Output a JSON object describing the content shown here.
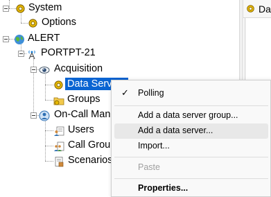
{
  "tree": {
    "system": "System",
    "options": "Options",
    "alert": "ALERT",
    "portpt": "PORTPT-21",
    "acquisition": "Acquisition",
    "data_servers": "Data Servers",
    "groups": "Groups",
    "on_call": "On-Call Man",
    "users": "Users",
    "call_groups": "Call Grou",
    "scenarios": "Scenarios"
  },
  "right_panel": {
    "header": "Da"
  },
  "context_menu": {
    "polling": "Polling",
    "polling_check": "✓",
    "add_group": "Add a data server group...",
    "add_server": "Add a data server...",
    "import": "Import...",
    "paste": "Paste",
    "properties": "Properties..."
  },
  "colors": {
    "selection": "#0a64d2",
    "menu_hover": "#e8e8e8",
    "disabled": "#a0a0a0"
  }
}
